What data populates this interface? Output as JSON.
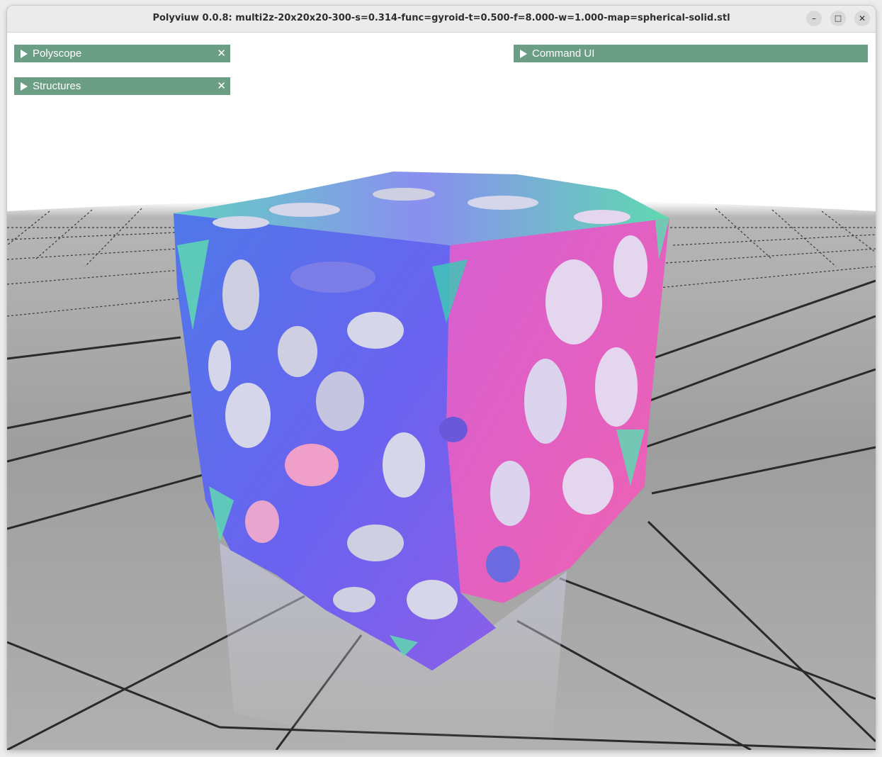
{
  "window": {
    "title": "Polyviuw 0.0.8: multi2z-20x20x20-300-s=0.314-func=gyroid-t=0.500-f=8.000-w=1.000-map=spherical-solid.stl",
    "controls": {
      "minimize": "–",
      "maximize": "□",
      "close": "✕"
    }
  },
  "panels": {
    "polyscope": {
      "label": "Polyscope",
      "close": "✕"
    },
    "structures": {
      "label": "Structures",
      "close": "✕"
    },
    "command_ui": {
      "label": "Command UI"
    }
  },
  "colors": {
    "panel_header": "#6b9e85",
    "floor": "#9c9c9c",
    "mesh_front": "#5a6af0",
    "mesh_right": "#e05fc8",
    "mesh_top": "#5fd9b8"
  }
}
